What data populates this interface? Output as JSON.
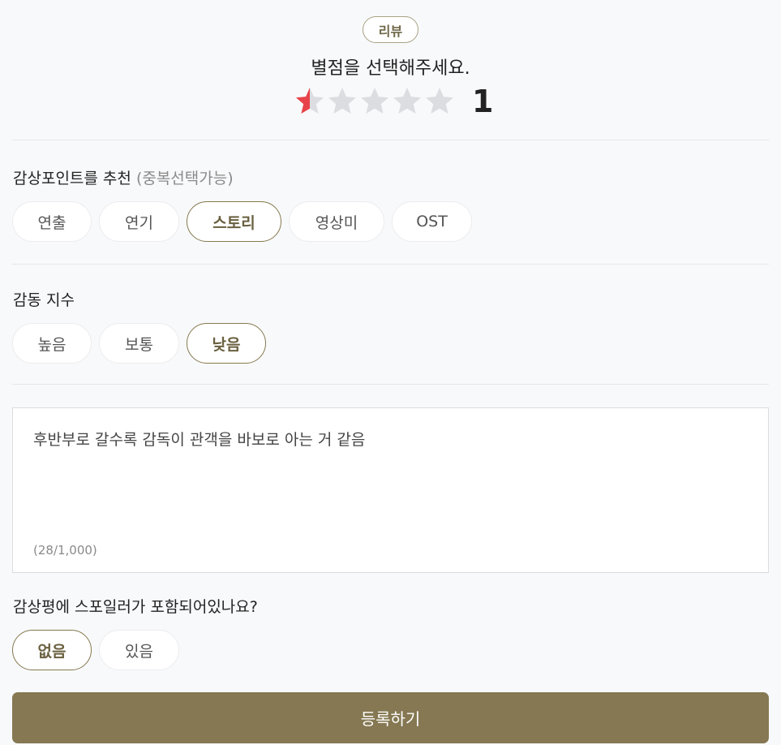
{
  "header": {
    "badge": "리뷰",
    "prompt": "별점을 선택해주세요.",
    "rating": {
      "value": 0.5,
      "max": 5,
      "score_label": "1"
    }
  },
  "colors": {
    "accent": "#857852",
    "star_filled": "#e8434a",
    "star_empty": "#dcdde0"
  },
  "recommend": {
    "title": "감상포인트를 추천",
    "title_note": "(중복선택가능)",
    "options": [
      {
        "label": "연출",
        "selected": false
      },
      {
        "label": "연기",
        "selected": false
      },
      {
        "label": "스토리",
        "selected": true
      },
      {
        "label": "영상미",
        "selected": false
      },
      {
        "label": "OST",
        "selected": false
      }
    ]
  },
  "emotion": {
    "title": "감동 지수",
    "options": [
      {
        "label": "높음",
        "selected": false
      },
      {
        "label": "보통",
        "selected": false
      },
      {
        "label": "낮음",
        "selected": true
      }
    ]
  },
  "review": {
    "text": "후반부로 갈수록 감독이 관객을 바보로 아는 거 같음",
    "counter": "(28/1,000)"
  },
  "spoiler": {
    "title": "감상평에 스포일러가 포함되어있나요?",
    "options": [
      {
        "label": "없음",
        "selected": true
      },
      {
        "label": "있음",
        "selected": false
      }
    ]
  },
  "submit": {
    "label": "등록하기"
  }
}
